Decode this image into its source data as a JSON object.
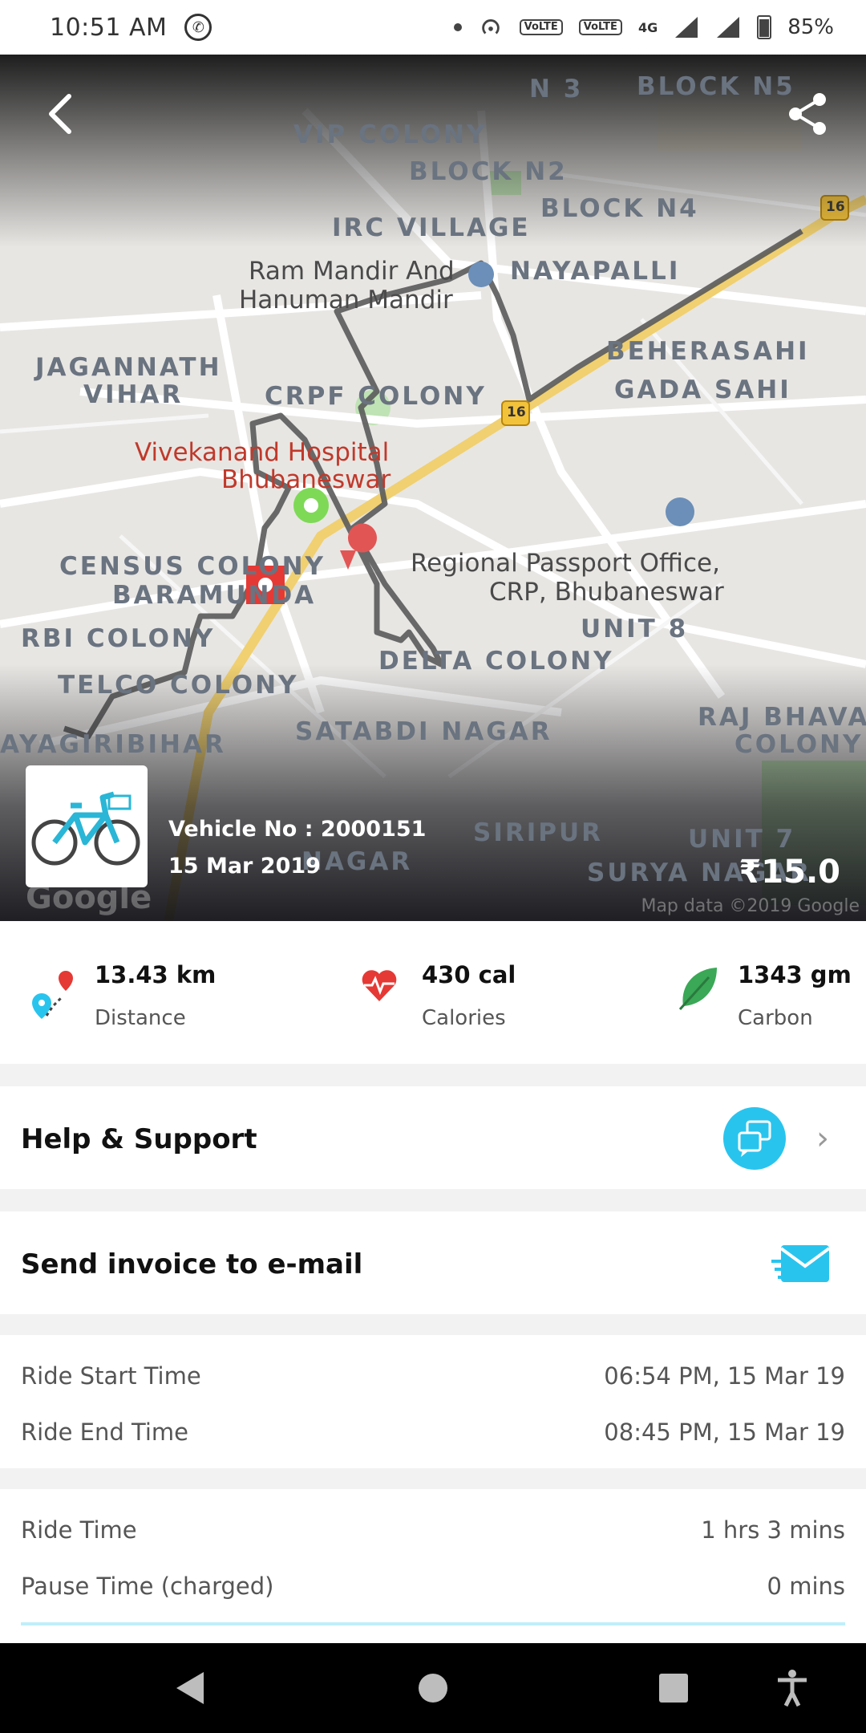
{
  "status_bar": {
    "time": "10:51 AM",
    "battery": "85%",
    "network": "4G",
    "sim1_badge": "VoLTE",
    "sim2_badge": "VoLTE"
  },
  "map": {
    "labels": [
      "N 3",
      "BLOCK N5",
      "VIP COLONY",
      "BLOCK N2",
      "BLOCK N4",
      "IRC VILLAGE",
      "Ram Mandir And",
      "Hanuman Mandir",
      "NAYAPALLI",
      "JAGANNATH",
      "VIHAR",
      "CRPF COLONY",
      "BEHERASAHI",
      "GADA SAHI",
      "Vivekanand Hospital",
      "Bhubaneswar",
      "Regional Passport Office,",
      "CRP, Bhubaneswar",
      "CENSUS COLONY",
      "BARAMUNDA",
      "UNIT 8",
      "RBI COLONY",
      "DELTA COLONY",
      "TELCO COLONY",
      "RAJ BHAVAN",
      "COLONY",
      "AYAGIRIBIHAR",
      "SATABDI NAGAR",
      "SIRIPUR",
      "UNIT 7",
      "SURYA NAGAR",
      "NAGAR"
    ],
    "highway_badge": "16",
    "credit": "Map data ©2019 Google",
    "google_logo": "Google"
  },
  "ride": {
    "vehicle_no": "Vehicle No : 2000151",
    "date": "15 Mar 2019",
    "fare": "₹15.0"
  },
  "stats": [
    {
      "value": "13.43 km",
      "label": "Distance",
      "icon": "distance-pin-icon"
    },
    {
      "value": "430 cal",
      "label": "Calories",
      "icon": "heart-pulse-icon"
    },
    {
      "value": "1343 gm",
      "label": "Carbon",
      "icon": "leaf-icon"
    }
  ],
  "help": {
    "label": "Help & Support"
  },
  "invoice": {
    "label": "Send invoice to e-mail"
  },
  "times": [
    {
      "label": "Ride Start Time",
      "value": "06:54 PM, 15 Mar 19"
    },
    {
      "label": "Ride End Time",
      "value": "08:45 PM, 15 Mar 19"
    }
  ],
  "durations": [
    {
      "label": "Ride Time",
      "value": "1 hrs 3 mins"
    },
    {
      "label": "Pause Time (charged)",
      "value": "0 mins"
    }
  ],
  "colors": {
    "accent": "#29c4ee",
    "route": "#555555",
    "start_marker": "#7ed957",
    "end_marker": "#e53935"
  }
}
